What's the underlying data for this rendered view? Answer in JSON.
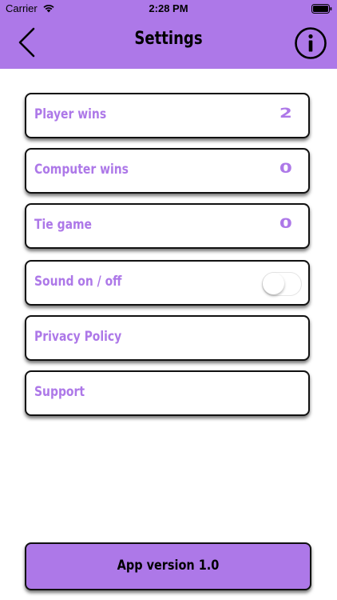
{
  "status_bar": {
    "carrier": "Carrier",
    "time": "2:28 PM"
  },
  "header": {
    "title": "Settings",
    "back_icon": "chevron-left-icon",
    "info_icon": "info-circle-icon"
  },
  "rows": [
    {
      "label": "Player wins",
      "value": "2"
    },
    {
      "label": "Computer wins",
      "value": "0"
    },
    {
      "label": "Tie game",
      "value": "0"
    },
    {
      "label": "Sound on / off",
      "toggle_on": false
    },
    {
      "label": "Privacy Policy"
    },
    {
      "label": "Support"
    }
  ],
  "footer": {
    "version_label": "App version 1.0"
  },
  "colors": {
    "accent": "#ad78e8",
    "border": "#111111",
    "background": "#ffffff"
  }
}
